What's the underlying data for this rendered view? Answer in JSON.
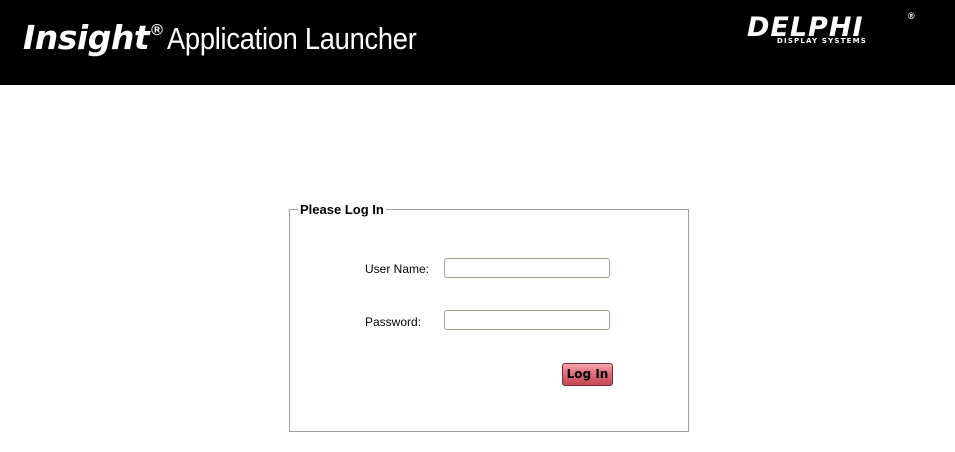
{
  "header": {
    "product_name": "Insight",
    "registered_mark": "®",
    "app_title": "Application Launcher",
    "company_logo": {
      "wordmark": "DELPHI",
      "tagline": "DISPLAY SYSTEMS",
      "registered_mark": "®"
    }
  },
  "login": {
    "legend": "Please Log In",
    "username_label": "User Name:",
    "username_value": "",
    "password_label": "Password:",
    "password_value": "",
    "submit_label": "Log In"
  },
  "colors": {
    "header_background": "#000000",
    "button_gradient_top": "#f4a6ae",
    "button_gradient_bottom": "#c44654"
  }
}
